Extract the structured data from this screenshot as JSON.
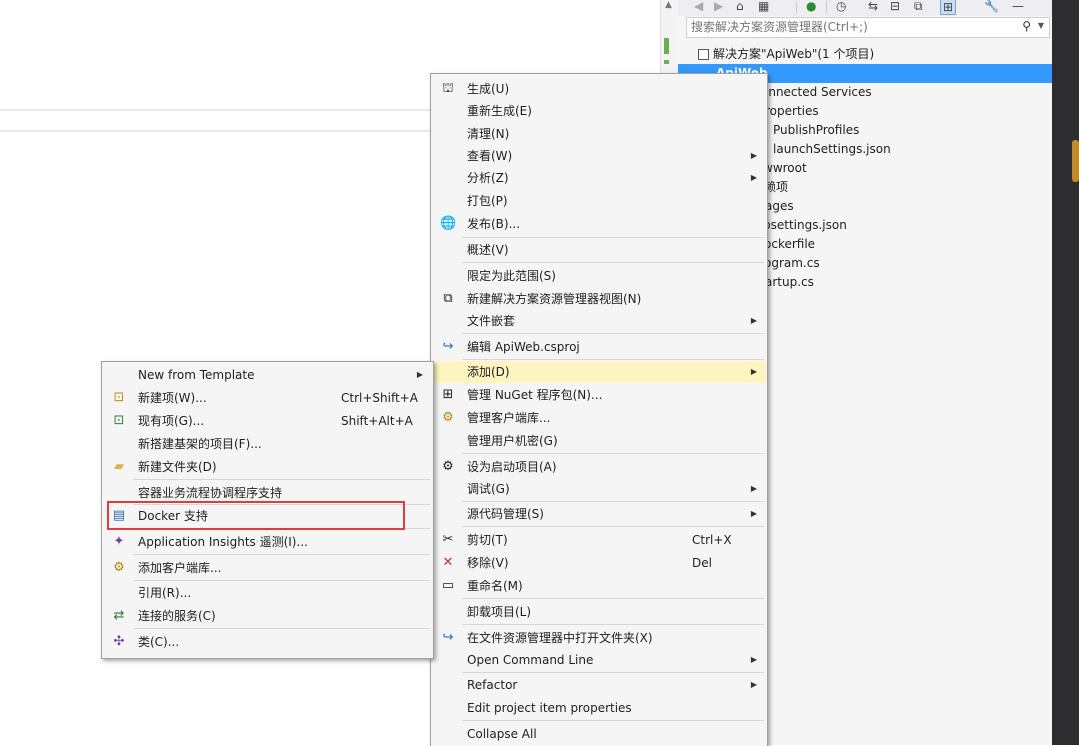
{
  "solution_explorer": {
    "search_placeholder": "搜索解决方案资源管理器(Ctrl+;)",
    "solution_node": "解决方案\"ApiWeb\"(1 个项目)",
    "project_node": "ApiWeb",
    "items": [
      "onnected Services",
      "roperties",
      "PublishProfiles",
      "launchSettings.json",
      "wwroot",
      "赖项",
      "ages",
      "psettings.json",
      "ockerfile",
      "ogram.cs",
      "artup.cs"
    ]
  },
  "main_menu": {
    "build": "生成(U)",
    "rebuild": "重新生成(E)",
    "clean": "清理(N)",
    "view": "查看(W)",
    "analyze": "分析(Z)",
    "pack": "打包(P)",
    "publish": "发布(B)...",
    "overview": "概述(V)",
    "scope": "限定为此范围(S)",
    "new_view": "新建解决方案资源管理器视图(N)",
    "file_nesting": "文件嵌套",
    "edit_proj": "编辑 ApiWeb.csproj",
    "add": "添加(D)",
    "nuget": "管理 NuGet 程序包(N)...",
    "client_libs": "管理客户端库...",
    "user_secrets": "管理用户机密(G)",
    "set_startup": "设为启动项目(A)",
    "debug": "调试(G)",
    "source_control": "源代码管理(S)",
    "cut": "剪切(T)",
    "cut_shortcut": "Ctrl+X",
    "remove": "移除(V)",
    "remove_shortcut": "Del",
    "rename": "重命名(M)",
    "unload": "卸载项目(L)",
    "open_folder": "在文件资源管理器中打开文件夹(X)",
    "open_cmd": "Open Command Line",
    "refactor": "Refactor",
    "edit_props": "Edit project item properties",
    "collapse": "Collapse All"
  },
  "add_menu": {
    "new_from_template": "New from Template",
    "new_item": "新建项(W)...",
    "new_item_shortcut": "Ctrl+Shift+A",
    "existing_item": "现有项(G)...",
    "existing_item_shortcut": "Shift+Alt+A",
    "scaffold": "新搭建基架的项目(F)...",
    "new_folder": "新建文件夹(D)",
    "orchestrator": "容器业务流程协调程序支持",
    "docker": "Docker 支持",
    "app_insights": "Application Insights 遥测(I)...",
    "client_lib": "添加客户端库...",
    "reference": "引用(R)...",
    "connected": "连接的服务(C)",
    "class": "类(C)..."
  },
  "colors": {
    "selection": "#3399ff",
    "menu_highlight": "#fdf4bf",
    "annotation_box": "#e23b3b"
  }
}
